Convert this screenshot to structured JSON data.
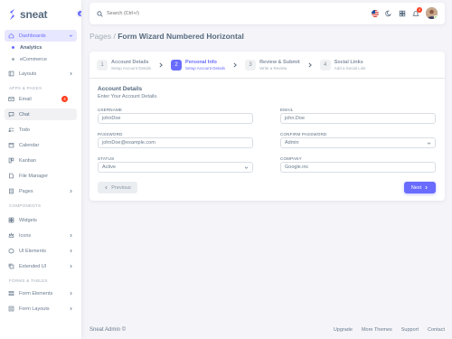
{
  "brand": {
    "name": "sneat"
  },
  "sidebar": {
    "dashboards": "Dashboards",
    "dashboard_subs": [
      "Analytics",
      "eCommerce"
    ],
    "layouts": "Layouts",
    "header_apps": "APPS & PAGES",
    "email": "Email",
    "email_badge": "4",
    "chat": "Chat",
    "todo": "Todo",
    "calendar": "Calendar",
    "kanban": "Kanban",
    "file_manager": "File Manager",
    "pages": "Pages",
    "header_components": "COMPONENTS",
    "widgets": "Widgets",
    "icons": "Icons",
    "ui_elements": "UI Elements",
    "extended_ui": "Extended UI",
    "header_forms": "FORMS & TABLES",
    "form_elements": "Form Elements",
    "form_layouts": "Form Layouts"
  },
  "navbar": {
    "search_placeholder": "Search (Ctrl+/)",
    "notif_count": "4"
  },
  "page": {
    "crumb": "Pages /",
    "title": " Form Wizard Numbered Horizontal"
  },
  "wizard": {
    "steps": [
      {
        "num": "1",
        "title": "Account Details",
        "sub": "Setup Account Details"
      },
      {
        "num": "2",
        "title": "Personal Info",
        "sub": "Setup Account Details"
      },
      {
        "num": "3",
        "title": "Review & Submit",
        "sub": "Write a Review"
      },
      {
        "num": "4",
        "title": "Social Links",
        "sub": "Add a Social Link"
      }
    ],
    "active_step": 2,
    "form_title": "Account Details",
    "form_subtitle": "Enter Your Account Details.",
    "fields": {
      "username": {
        "label": "USERNAME",
        "value": "johnDoe"
      },
      "email": {
        "label": "EMAIL",
        "value": "john.Doe"
      },
      "password": {
        "label": "PASSWORD",
        "value": "johnDoe@example.com"
      },
      "confirm_password": {
        "label": "CONFIRM PASSWORD",
        "value": "Admin"
      },
      "status": {
        "label": "STATUS",
        "value": "Active"
      },
      "company": {
        "label": "COMPANY",
        "value": "Google.inc"
      }
    },
    "prev_label": "Previous",
    "next_label": "Next"
  },
  "footer": {
    "brand": "Sneat Admin ©",
    "links": [
      "Upgrade",
      "More Themes",
      "Support",
      "Contact"
    ]
  },
  "colors": {
    "primary": "#696cff",
    "danger": "#ff3e1d",
    "text": "#566a7f"
  }
}
